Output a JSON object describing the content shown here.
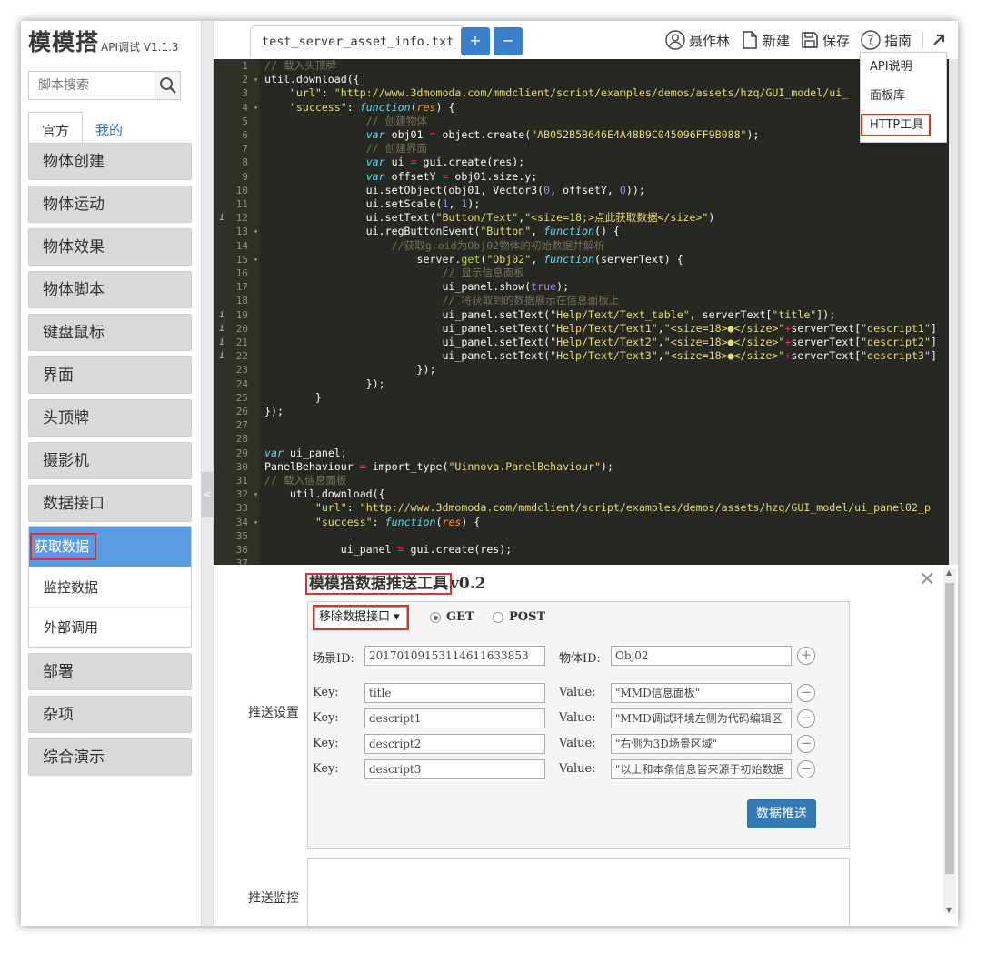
{
  "app": {
    "logo_text": "模模搭",
    "logo_sub": "API调试 V1.1.3"
  },
  "search": {
    "placeholder": "脚本搜索"
  },
  "sidebar": {
    "tabs": [
      {
        "label": "官方"
      },
      {
        "label": "我的"
      }
    ],
    "items": [
      {
        "label": "物体创建"
      },
      {
        "label": "物体运动"
      },
      {
        "label": "物体效果"
      },
      {
        "label": "物体脚本"
      },
      {
        "label": "键盘鼠标"
      },
      {
        "label": "界面"
      },
      {
        "label": "头顶牌"
      },
      {
        "label": "摄影机"
      },
      {
        "label": "数据接口"
      }
    ],
    "subitems": [
      {
        "label": "获取数据"
      },
      {
        "label": "监控数据"
      },
      {
        "label": "外部调用"
      }
    ],
    "items_after": [
      {
        "label": "部署"
      },
      {
        "label": "杂项"
      },
      {
        "label": "综合演示"
      }
    ]
  },
  "editor": {
    "file_tab": "test_server_asset_info.txt",
    "add_label": "+",
    "remove_label": "−"
  },
  "toolbar": {
    "user_name": "聂作林",
    "new_label": "新建",
    "save_label": "保存",
    "guide_label": "指南"
  },
  "guide_menu": {
    "items": [
      {
        "label": "API说明"
      },
      {
        "label": "面板库"
      },
      {
        "label": "HTTP工具"
      }
    ]
  },
  "panel": {
    "title": "模模搭数据推送工具",
    "version": "v0.2",
    "method_select": "移除数据接口 ▾",
    "radio_get": "GET",
    "radio_post": "POST",
    "scene_id_label": "场景ID:",
    "scene_id_value": "20170109153114611633853",
    "object_id_label": "物体ID:",
    "object_id_value": "Obj02",
    "key_label": "Key:",
    "value_label": "Value:",
    "pairs": [
      {
        "key": "title",
        "value": "\"MMD信息面板\""
      },
      {
        "key": "descript1",
        "value": "\"MMD调试环境左侧为代码编辑区"
      },
      {
        "key": "descript2",
        "value": "\"右侧为3D场景区域\""
      },
      {
        "key": "descript3",
        "value": "\"以上和本条信息皆来源于初始数据"
      }
    ],
    "push_settings_label": "推送设置",
    "push_button": "数据推送",
    "push_monitor_label": "推送监控"
  }
}
